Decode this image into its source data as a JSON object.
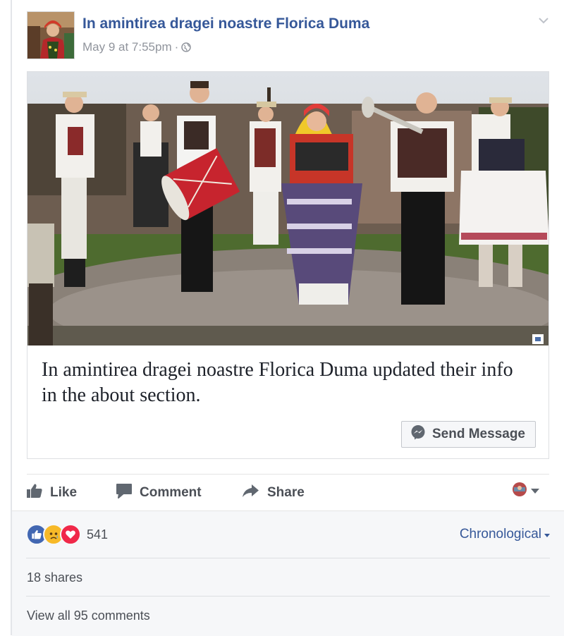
{
  "post": {
    "page_name": "In amintirea dragei noastre Florica Duma",
    "timestamp": "May 9 at 7:55pm",
    "separator": "·",
    "privacy_icon": "globe-icon",
    "menu_icon": "chevron-down-icon"
  },
  "card": {
    "text": "In amintirea dragei noastre Florica Duma updated their info in the about section.",
    "send_button_label": "Send Message",
    "send_button_icon": "messenger-icon"
  },
  "actions": {
    "like": "Like",
    "comment": "Comment",
    "share": "Share"
  },
  "stats": {
    "reactions": [
      "like-icon",
      "sad-icon",
      "love-icon"
    ],
    "reaction_count": "541",
    "sort_label": "Chronological",
    "shares": "18 shares",
    "view_comments": "View all 95 comments"
  },
  "colors": {
    "link_blue": "#365899",
    "like_blue": "#4267b2",
    "love_red": "#f02849",
    "sad_yellow": "#f7b928"
  }
}
